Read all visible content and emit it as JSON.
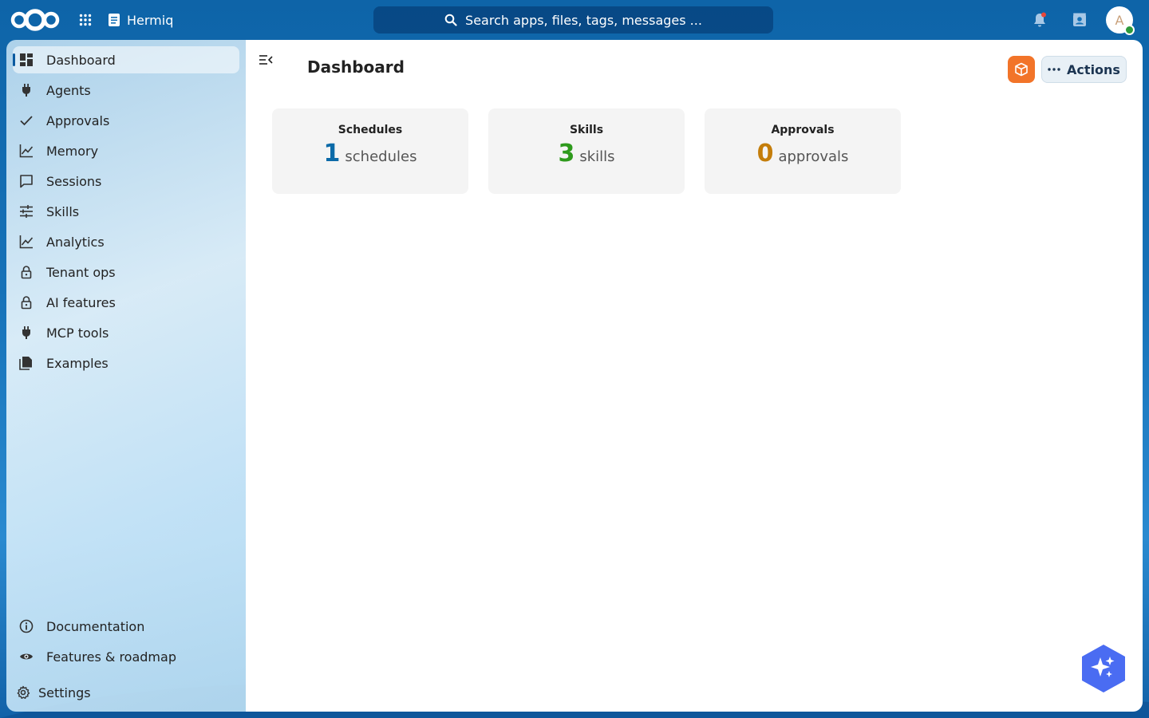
{
  "header": {
    "app_name": "Hermiq",
    "search_placeholder": "Search apps, files, tags, messages ...",
    "avatar_initial": "A"
  },
  "sidebar": {
    "items": [
      {
        "label": "Dashboard",
        "icon": "dashboard-icon",
        "active": true
      },
      {
        "label": "Agents",
        "icon": "plug-icon"
      },
      {
        "label": "Approvals",
        "icon": "check-icon"
      },
      {
        "label": "Memory",
        "icon": "chart-line-icon"
      },
      {
        "label": "Sessions",
        "icon": "message-square-icon"
      },
      {
        "label": "Skills",
        "icon": "sliders-icon"
      },
      {
        "label": "Analytics",
        "icon": "chart-line-icon"
      },
      {
        "label": "Tenant ops",
        "icon": "lock-icon"
      },
      {
        "label": "AI features",
        "icon": "lock-icon"
      },
      {
        "label": "MCP tools",
        "icon": "plug-icon"
      },
      {
        "label": "Examples",
        "icon": "documents-icon"
      }
    ],
    "footer": [
      {
        "label": "Documentation",
        "icon": "info-icon"
      },
      {
        "label": "Features & roadmap",
        "icon": "eye-icon"
      }
    ],
    "settings_label": "Settings"
  },
  "main": {
    "title": "Dashboard",
    "actions_label": "Actions",
    "cards": [
      {
        "title": "Schedules",
        "value": "1",
        "unit": "schedules",
        "color": "#0b6aa8"
      },
      {
        "title": "Skills",
        "value": "3",
        "unit": "skills",
        "color": "#2e9a1c"
      },
      {
        "title": "Approvals",
        "value": "0",
        "unit": "approvals",
        "color": "#c47d0a"
      }
    ]
  },
  "colors": {
    "accent": "#0b5aa0",
    "orange_button": "#f27429",
    "fab": "#4a6cf2"
  }
}
